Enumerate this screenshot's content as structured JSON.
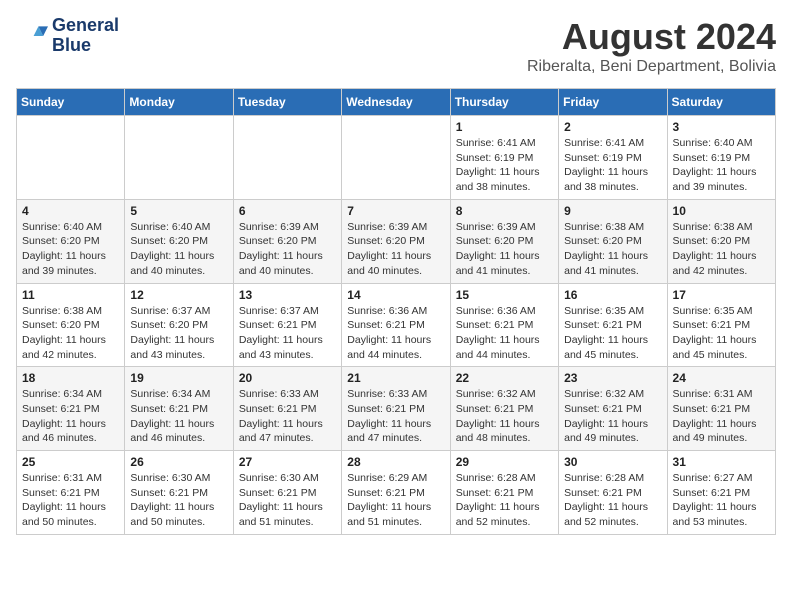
{
  "header": {
    "logo_line1": "General",
    "logo_line2": "Blue",
    "month": "August 2024",
    "location": "Riberalta, Beni Department, Bolivia"
  },
  "weekdays": [
    "Sunday",
    "Monday",
    "Tuesday",
    "Wednesday",
    "Thursday",
    "Friday",
    "Saturday"
  ],
  "weeks": [
    [
      {
        "day": "",
        "info": ""
      },
      {
        "day": "",
        "info": ""
      },
      {
        "day": "",
        "info": ""
      },
      {
        "day": "",
        "info": ""
      },
      {
        "day": "1",
        "info": "Sunrise: 6:41 AM\nSunset: 6:19 PM\nDaylight: 11 hours\nand 38 minutes."
      },
      {
        "day": "2",
        "info": "Sunrise: 6:41 AM\nSunset: 6:19 PM\nDaylight: 11 hours\nand 38 minutes."
      },
      {
        "day": "3",
        "info": "Sunrise: 6:40 AM\nSunset: 6:19 PM\nDaylight: 11 hours\nand 39 minutes."
      }
    ],
    [
      {
        "day": "4",
        "info": "Sunrise: 6:40 AM\nSunset: 6:20 PM\nDaylight: 11 hours\nand 39 minutes."
      },
      {
        "day": "5",
        "info": "Sunrise: 6:40 AM\nSunset: 6:20 PM\nDaylight: 11 hours\nand 40 minutes."
      },
      {
        "day": "6",
        "info": "Sunrise: 6:39 AM\nSunset: 6:20 PM\nDaylight: 11 hours\nand 40 minutes."
      },
      {
        "day": "7",
        "info": "Sunrise: 6:39 AM\nSunset: 6:20 PM\nDaylight: 11 hours\nand 40 minutes."
      },
      {
        "day": "8",
        "info": "Sunrise: 6:39 AM\nSunset: 6:20 PM\nDaylight: 11 hours\nand 41 minutes."
      },
      {
        "day": "9",
        "info": "Sunrise: 6:38 AM\nSunset: 6:20 PM\nDaylight: 11 hours\nand 41 minutes."
      },
      {
        "day": "10",
        "info": "Sunrise: 6:38 AM\nSunset: 6:20 PM\nDaylight: 11 hours\nand 42 minutes."
      }
    ],
    [
      {
        "day": "11",
        "info": "Sunrise: 6:38 AM\nSunset: 6:20 PM\nDaylight: 11 hours\nand 42 minutes."
      },
      {
        "day": "12",
        "info": "Sunrise: 6:37 AM\nSunset: 6:20 PM\nDaylight: 11 hours\nand 43 minutes."
      },
      {
        "day": "13",
        "info": "Sunrise: 6:37 AM\nSunset: 6:21 PM\nDaylight: 11 hours\nand 43 minutes."
      },
      {
        "day": "14",
        "info": "Sunrise: 6:36 AM\nSunset: 6:21 PM\nDaylight: 11 hours\nand 44 minutes."
      },
      {
        "day": "15",
        "info": "Sunrise: 6:36 AM\nSunset: 6:21 PM\nDaylight: 11 hours\nand 44 minutes."
      },
      {
        "day": "16",
        "info": "Sunrise: 6:35 AM\nSunset: 6:21 PM\nDaylight: 11 hours\nand 45 minutes."
      },
      {
        "day": "17",
        "info": "Sunrise: 6:35 AM\nSunset: 6:21 PM\nDaylight: 11 hours\nand 45 minutes."
      }
    ],
    [
      {
        "day": "18",
        "info": "Sunrise: 6:34 AM\nSunset: 6:21 PM\nDaylight: 11 hours\nand 46 minutes."
      },
      {
        "day": "19",
        "info": "Sunrise: 6:34 AM\nSunset: 6:21 PM\nDaylight: 11 hours\nand 46 minutes."
      },
      {
        "day": "20",
        "info": "Sunrise: 6:33 AM\nSunset: 6:21 PM\nDaylight: 11 hours\nand 47 minutes."
      },
      {
        "day": "21",
        "info": "Sunrise: 6:33 AM\nSunset: 6:21 PM\nDaylight: 11 hours\nand 47 minutes."
      },
      {
        "day": "22",
        "info": "Sunrise: 6:32 AM\nSunset: 6:21 PM\nDaylight: 11 hours\nand 48 minutes."
      },
      {
        "day": "23",
        "info": "Sunrise: 6:32 AM\nSunset: 6:21 PM\nDaylight: 11 hours\nand 49 minutes."
      },
      {
        "day": "24",
        "info": "Sunrise: 6:31 AM\nSunset: 6:21 PM\nDaylight: 11 hours\nand 49 minutes."
      }
    ],
    [
      {
        "day": "25",
        "info": "Sunrise: 6:31 AM\nSunset: 6:21 PM\nDaylight: 11 hours\nand 50 minutes."
      },
      {
        "day": "26",
        "info": "Sunrise: 6:30 AM\nSunset: 6:21 PM\nDaylight: 11 hours\nand 50 minutes."
      },
      {
        "day": "27",
        "info": "Sunrise: 6:30 AM\nSunset: 6:21 PM\nDaylight: 11 hours\nand 51 minutes."
      },
      {
        "day": "28",
        "info": "Sunrise: 6:29 AM\nSunset: 6:21 PM\nDaylight: 11 hours\nand 51 minutes."
      },
      {
        "day": "29",
        "info": "Sunrise: 6:28 AM\nSunset: 6:21 PM\nDaylight: 11 hours\nand 52 minutes."
      },
      {
        "day": "30",
        "info": "Sunrise: 6:28 AM\nSunset: 6:21 PM\nDaylight: 11 hours\nand 52 minutes."
      },
      {
        "day": "31",
        "info": "Sunrise: 6:27 AM\nSunset: 6:21 PM\nDaylight: 11 hours\nand 53 minutes."
      }
    ]
  ]
}
